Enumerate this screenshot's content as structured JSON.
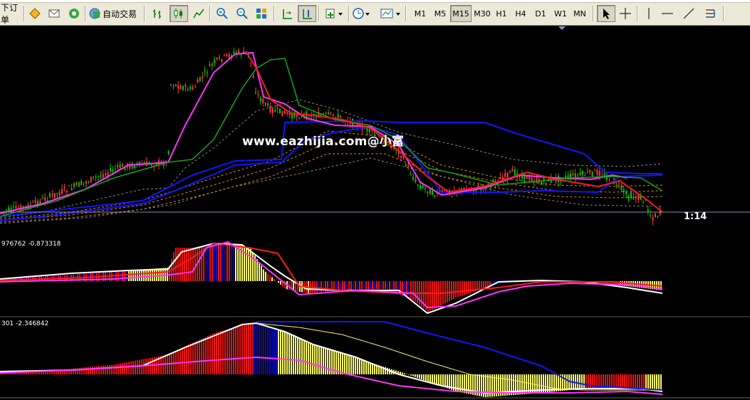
{
  "toolbar": {
    "order_label": "下订单",
    "autotrade_label": "自动交易",
    "timeframes": [
      "M1",
      "M5",
      "M15",
      "M30",
      "H1",
      "H4",
      "D1",
      "W1",
      "MN"
    ],
    "active_timeframe": "M15",
    "icons": [
      "new-order-icon",
      "metaeditor-icon",
      "email-icon",
      "signal-icon",
      "autotrade-icon",
      "bar-chart-icon",
      "candle-chart-icon",
      "line-chart-icon",
      "zoom-in-icon",
      "zoom-out-icon",
      "tile-windows-icon",
      "autoscroll-icon",
      "chart-shift-icon",
      "indicators-icon",
      "periodicity-icon",
      "templates-icon",
      "cursor-icon",
      "crosshair-icon",
      "vertical-line-icon",
      "horizontal-line-icon",
      "trendline-icon",
      "fibonacci-icon"
    ]
  },
  "chart": {
    "watermark": "www.eazhijia.com@小富",
    "timer": "1:14",
    "indicator1_values": "976762 -0.873318",
    "indicator2_values": "301 -2.346842",
    "colors": {
      "background": "#000000",
      "up_candle": "#00c800",
      "down_candle": "#ff3b3b",
      "band_blue": "#1414ff",
      "magenta": "#ff33ff",
      "green": "#16a516",
      "red": "#ff1a1a",
      "orange_dash": "#e08a1a",
      "gray_dash": "#888888",
      "hist_red": "#e81414",
      "hist_blue": "#0a0ab4",
      "hist_yellow": "#ffff64",
      "price_line": "#8c8cb4"
    }
  }
}
